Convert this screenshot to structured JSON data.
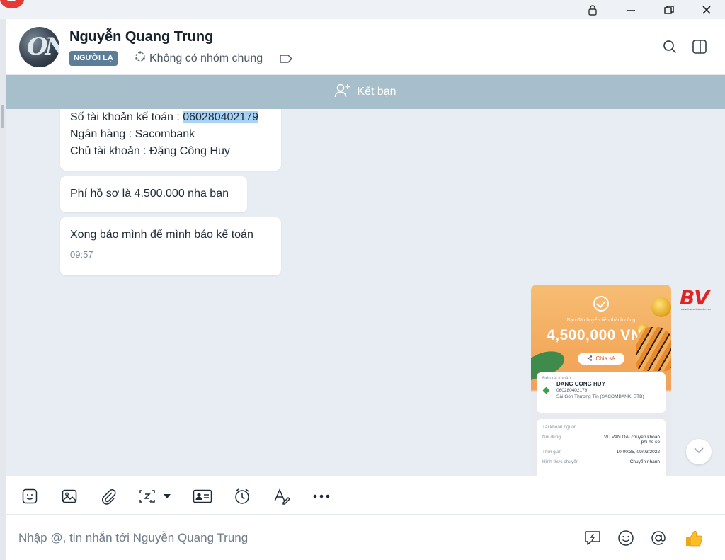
{
  "window": {
    "controls": [
      "lock-icon",
      "minimize-icon",
      "restore-icon",
      "close-icon"
    ]
  },
  "header": {
    "name": "Nguyễn Quang Trung",
    "badge": "NGƯỜI LẠ",
    "groups_text": "Không có nhóm chung",
    "avatar_letters": "ON",
    "actions": [
      "search-icon",
      "side-panel-icon"
    ]
  },
  "friend_bar": {
    "label": "Kết bạn"
  },
  "messages": [
    {
      "lines": [
        "Số tài khoản kế toán : ",
        "060280402179",
        "Ngân hàng : Sacombank",
        "Chủ tài khoản : Đặng Công Huy"
      ]
    },
    {
      "text": "Phí hồ sơ là 4.500.000 nha bạn"
    },
    {
      "text": "Xong báo mình để mình báo kế toán",
      "time": "09:57"
    }
  ],
  "receipt": {
    "caption": "Bạn đã chuyển tiền thành công",
    "amount": "4,500,000 VND",
    "share_label": "Chia sẻ",
    "to_label": "Đến tài khoản",
    "to_name": "DANG CONG HUY",
    "to_account": "060280402179",
    "to_bank": "Sài Gòn Thương Tín (SACOMBANK, STB)",
    "source_label": "Tài khoản nguồn",
    "content_label": "Nội dung",
    "content_value": "VU VAN OAI chuyen khoan phi ho so",
    "time_label": "Thời gian",
    "time_value": "10:00:35, 09/03/2022",
    "method_label": "Hình thức chuyển",
    "method_value": "Chuyển nhanh"
  },
  "watermark": {
    "text": "BV",
    "tagline": "www.baovethienhien.vn"
  },
  "toolbar": {
    "items": [
      "sticker-icon",
      "image-icon",
      "attach-icon",
      "screenshot-icon",
      "dropdown-caret-icon",
      "contact-card-icon",
      "reminder-icon",
      "text-format-icon",
      "more-icon"
    ]
  },
  "composer": {
    "placeholder": "Nhập @, tin nhắn tới Nguyễn Quang Trung",
    "actions": [
      "quick-message-icon",
      "emoji-icon",
      "mention-icon",
      "thumbs-up-icon"
    ]
  },
  "colors": {
    "friend_bar": "#a6bfcb",
    "badge": "#5a7d98",
    "highlight": "#a9d3f5",
    "chat_bg": "#e8edf4"
  }
}
